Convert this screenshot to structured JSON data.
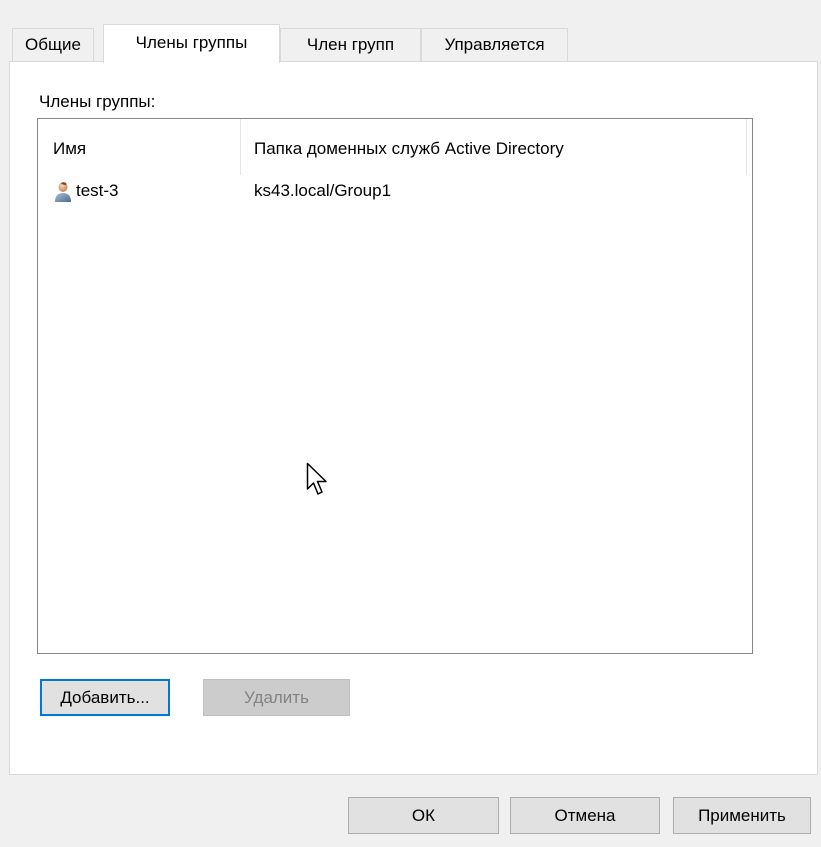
{
  "tabs": [
    {
      "label": "Общие"
    },
    {
      "label": "Члены группы"
    },
    {
      "label": "Член групп"
    },
    {
      "label": "Управляется"
    }
  ],
  "members_label": "Члены группы:",
  "list": {
    "columns": [
      "Имя",
      "Папка доменных служб Active Directory"
    ],
    "rows": [
      {
        "name": "test-3",
        "folder": "ks43.local/Group1",
        "icon": "user-icon"
      }
    ]
  },
  "buttons": {
    "add": "Добавить...",
    "remove": "Удалить",
    "ok": "ОК",
    "cancel": "Отмена",
    "apply": "Применить"
  },
  "colors": {
    "accent": "#0078d7",
    "window_bg": "#f0f0f0",
    "panel_bg": "#ffffff"
  }
}
